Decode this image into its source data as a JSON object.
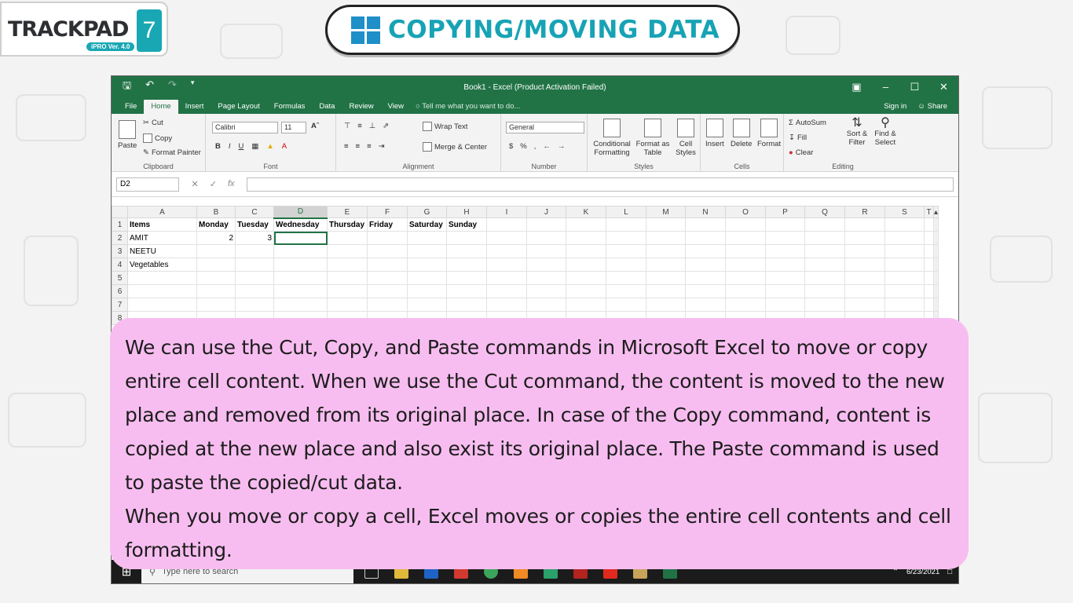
{
  "logo": {
    "name": "TRACKPAD",
    "version": "iPRO Ver. 4.0",
    "number": "7"
  },
  "header": {
    "title": "COPYING/MOVING DATA"
  },
  "excel": {
    "window_title": "Book1 - Excel (Product Activation Failed)",
    "menu": {
      "tabs": [
        "File",
        "Home",
        "Insert",
        "Page Layout",
        "Formulas",
        "Data",
        "Review",
        "View"
      ],
      "tell_me": "Tell me what you want to do...",
      "sign_in": "Sign in",
      "share": "Share"
    },
    "ribbon": {
      "clipboard": {
        "paste": "Paste",
        "cut": "Cut",
        "copy": "Copy",
        "format_painter": "Format Painter",
        "label": "Clipboard"
      },
      "font": {
        "name": "Calibri",
        "size": "11",
        "label": "Font"
      },
      "alignment": {
        "wrap_text": "Wrap Text",
        "merge_center": "Merge & Center",
        "label": "Alignment"
      },
      "number": {
        "format": "General",
        "label": "Number"
      },
      "styles": {
        "conditional": "Conditional Formatting",
        "format_table": "Format as Table",
        "cell_styles": "Cell Styles",
        "label": "Styles"
      },
      "cells": {
        "insert": "Insert",
        "delete": "Delete",
        "format": "Format",
        "label": "Cells"
      },
      "editing": {
        "autosum": "AutoSum",
        "fill": "Fill",
        "clear": "Clear",
        "sort": "Sort & Filter",
        "find": "Find & Select",
        "label": "Editing"
      }
    },
    "name_box": "D2",
    "columns": [
      "A",
      "B",
      "C",
      "D",
      "E",
      "F",
      "G",
      "H",
      "I",
      "J",
      "K",
      "L",
      "M",
      "N",
      "O",
      "P",
      "Q",
      "R",
      "S",
      "T"
    ],
    "rows": [
      {
        "num": "1",
        "cells": [
          "Items",
          "Monday",
          "Tuesday",
          "Wednesday",
          "Thursday",
          "Friday",
          "Saturday",
          "Sunday"
        ]
      },
      {
        "num": "2",
        "cells": [
          "AMIT",
          "2",
          "3",
          "",
          "",
          "",
          "",
          ""
        ]
      },
      {
        "num": "3",
        "cells": [
          "NEETU",
          "",
          "",
          "",
          "",
          "",
          "",
          ""
        ]
      },
      {
        "num": "4",
        "cells": [
          "Vegetables",
          "",
          "",
          "",
          "",
          "",
          "",
          ""
        ]
      },
      {
        "num": "5",
        "cells": []
      },
      {
        "num": "6",
        "cells": []
      },
      {
        "num": "7",
        "cells": []
      },
      {
        "num": "8",
        "cells": []
      }
    ],
    "taskbar": {
      "search_placeholder": "Type here to search",
      "date": "6/23/2021"
    }
  },
  "caption": {
    "p1": "We can use the Cut, Copy, and Paste commands in Microsoft Excel to move or copy entire cell content. When we use the Cut command, the content is moved to the new place and removed from its original place. In case of the Copy command, content is copied at the new place and also exist its original place. The Paste command is used to paste the copied/cut data.",
    "p2": "When you move or copy a cell, Excel moves or copies the entire cell contents and cell formatting."
  },
  "colors": {
    "excel_green": "#217346",
    "caption_bg": "#f7bdf0",
    "brand_teal": "#19a7b4"
  }
}
